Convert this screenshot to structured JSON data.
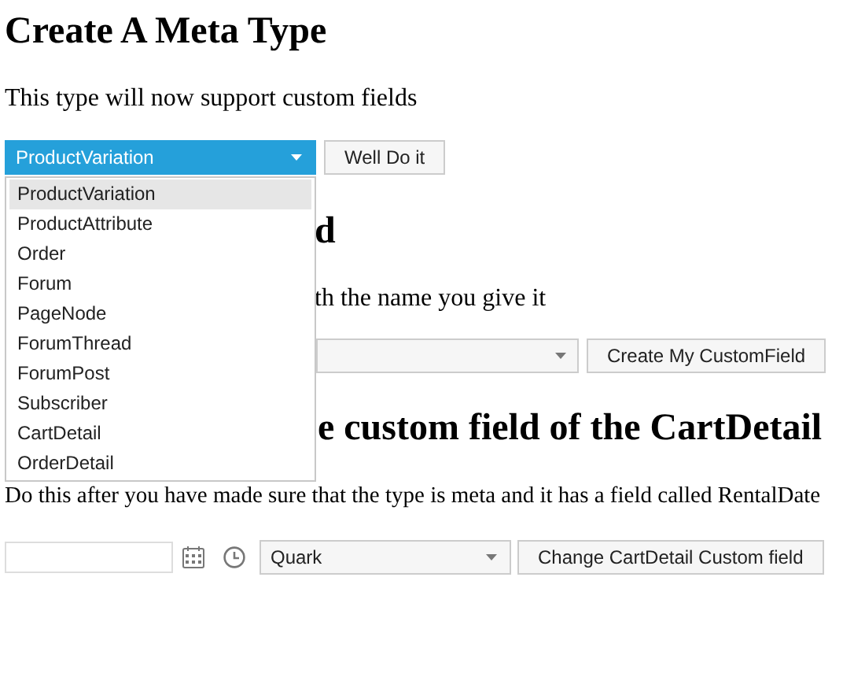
{
  "title": "Create A Meta Type",
  "intro": "This type will now support custom fields",
  "type_select": {
    "value": "ProductVariation",
    "expanded": true,
    "options": [
      {
        "label": "ProductVariation",
        "selected": true
      },
      {
        "label": "ProductAttribute",
        "selected": false
      },
      {
        "label": "Order",
        "selected": false
      },
      {
        "label": "Forum",
        "selected": false
      },
      {
        "label": "PageNode",
        "selected": false
      },
      {
        "label": "ForumThread",
        "selected": false
      },
      {
        "label": "ForumPost",
        "selected": false
      },
      {
        "label": "Subscriber",
        "selected": false
      },
      {
        "label": "CartDetail",
        "selected": false
      },
      {
        "label": "OrderDetail",
        "selected": false
      }
    ]
  },
  "apply_button": "Well Do it",
  "section_2": {
    "heading": "d",
    "text": "th the name you give it",
    "button": "Create My CustomField"
  },
  "section_3": {
    "heading": "e custom field of the CartDetail",
    "text": "Do this after you have made sure that the type is meta and it has a field called RentalDate",
    "select": {
      "value": "Quark"
    },
    "button": "Change CartDetail Custom field"
  }
}
